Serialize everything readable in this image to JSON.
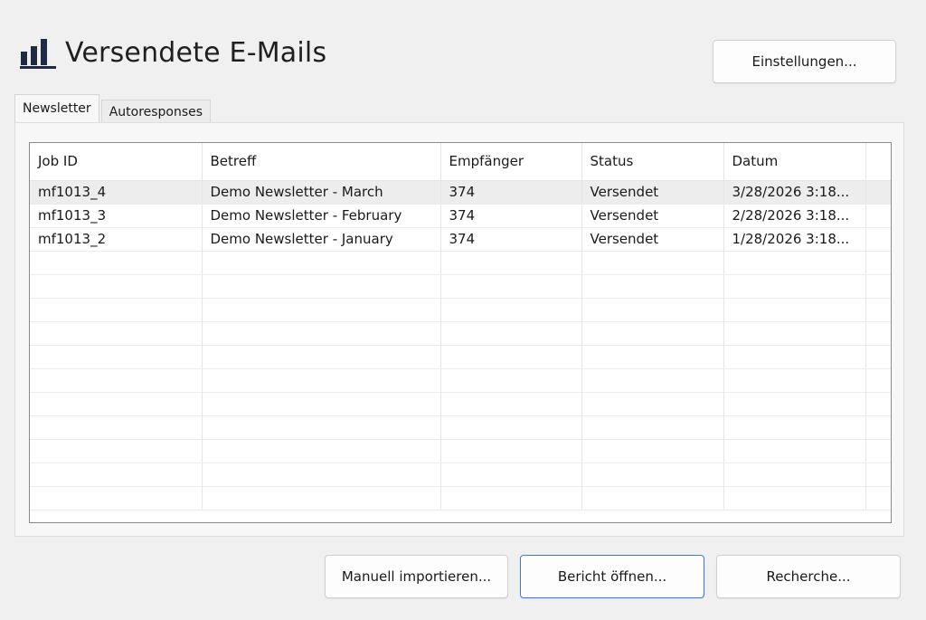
{
  "header": {
    "title": "Versendete E-Mails",
    "icon": "bar-chart-icon"
  },
  "buttons": {
    "settings": "Einstellungen...",
    "import": "Manuell importieren...",
    "report": "Bericht öffnen...",
    "research": "Recherche..."
  },
  "tabs": [
    {
      "label": "Newsletter",
      "active": true
    },
    {
      "label": "Autoresponses",
      "active": false
    }
  ],
  "table": {
    "columns": [
      "Job ID",
      "Betreff",
      "Empfänger",
      "Status",
      "Datum"
    ],
    "rows": [
      [
        "mf1013_4",
        "Demo Newsletter - March",
        "374",
        "Versendet",
        "3/28/2026 3:18..."
      ],
      [
        "mf1013_3",
        "Demo Newsletter - February",
        "374",
        "Versendet",
        "2/28/2026 3:18..."
      ],
      [
        "mf1013_2",
        "Demo Newsletter - January",
        "374",
        "Versendet",
        "1/28/2026 3:18..."
      ]
    ]
  },
  "colors": {
    "accent": "#3a7bd5",
    "selected_row": "#ededed",
    "background": "#f0f0f0"
  }
}
